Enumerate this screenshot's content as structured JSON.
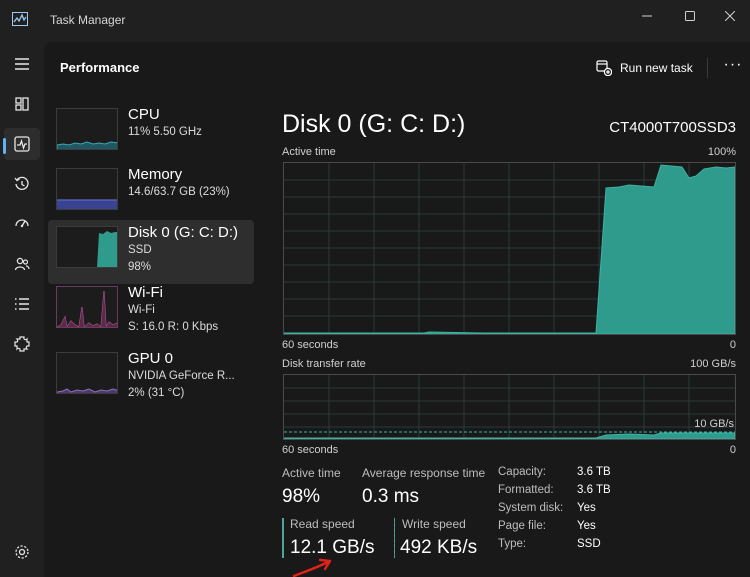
{
  "app": {
    "title": "Task Manager",
    "icon": "task-manager-icon"
  },
  "window_controls": [
    "minimize-icon",
    "maximize-icon",
    "close-icon"
  ],
  "nav": {
    "items": [
      {
        "icon": "hamburger-menu-icon"
      },
      {
        "icon": "processes-icon"
      },
      {
        "icon": "performance-icon",
        "active": true
      },
      {
        "icon": "app-history-icon"
      },
      {
        "icon": "startup-apps-icon"
      },
      {
        "icon": "users-icon"
      },
      {
        "icon": "details-icon"
      },
      {
        "icon": "services-icon"
      },
      {
        "icon": "settings-icon"
      }
    ]
  },
  "header": {
    "title": "Performance",
    "run_task": "Run new task",
    "more": "···"
  },
  "devices": [
    {
      "name": "CPU",
      "line1": "11%  5.50 GHz",
      "line2": "",
      "color": "#3fa7b7"
    },
    {
      "name": "Memory",
      "line1": "14.6/63.7 GB (23%)",
      "line2": "",
      "color": "#5b67c7"
    },
    {
      "name": "Disk 0 (G: C: D:)",
      "line1": "SSD",
      "line2": "98%",
      "color": "#2f9b8d",
      "active": true
    },
    {
      "name": "Wi-Fi",
      "line1": "Wi-Fi",
      "line2": "S: 16.0  R: 0 Kbps",
      "color": "#c15a9c"
    },
    {
      "name": "GPU 0",
      "line1": "NVIDIA GeForce R...",
      "line2": "2%  (31 °C)",
      "color": "#8e6cc2"
    }
  ],
  "detail": {
    "title": "Disk 0 (G: C: D:)",
    "model": "CT4000T700SSD3",
    "active_time": {
      "label": "Active time",
      "max": "100%",
      "time": "60 seconds",
      "min": "0"
    },
    "transfer": {
      "label": "Disk transfer rate",
      "max": "100 GB/s",
      "mid": "10 GB/s",
      "time": "60 seconds",
      "min": "0"
    },
    "stats": {
      "active_time_label": "Active time",
      "active_time_value": "98%",
      "avg_resp_label": "Average response time",
      "avg_resp_value": "0.3 ms",
      "read_label": "Read speed",
      "read_value": "12.1 GB/s",
      "write_label": "Write speed",
      "write_value": "492 KB/s"
    },
    "properties": [
      {
        "label": "Capacity:",
        "value": "3.6 TB"
      },
      {
        "label": "Formatted:",
        "value": "3.6 TB"
      },
      {
        "label": "System disk:",
        "value": "Yes"
      },
      {
        "label": "Page file:",
        "value": "Yes"
      },
      {
        "label": "Type:",
        "value": "SSD"
      }
    ]
  },
  "colors": {
    "accent": "#5fb2f2",
    "disk": "#2f9b8d",
    "annotation": "#e2231a"
  }
}
